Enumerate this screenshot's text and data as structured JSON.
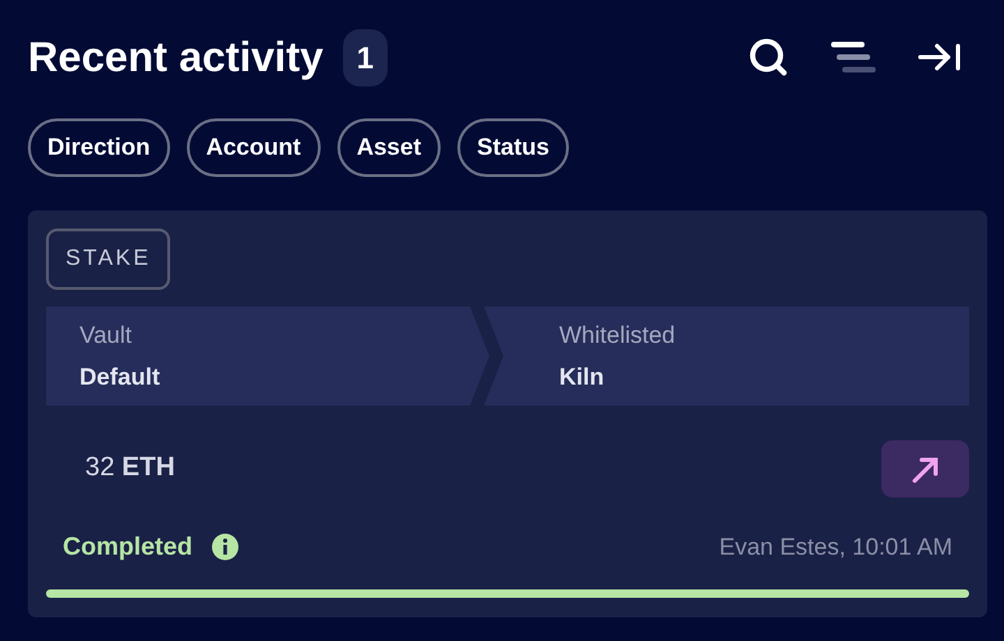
{
  "header": {
    "title": "Recent activity",
    "count": "1"
  },
  "filters": [
    "Direction",
    "Account",
    "Asset",
    "Status"
  ],
  "activity": {
    "type": "STAKE",
    "steps": [
      {
        "label": "Vault",
        "value": "Default"
      },
      {
        "label": "Whitelisted",
        "value": "Kiln"
      }
    ],
    "amount": "32 **ETH**",
    "status": "Completed",
    "meta": "Evan Estes, 10:01 AM",
    "progress": {
      "level": 1
    }
  }
}
